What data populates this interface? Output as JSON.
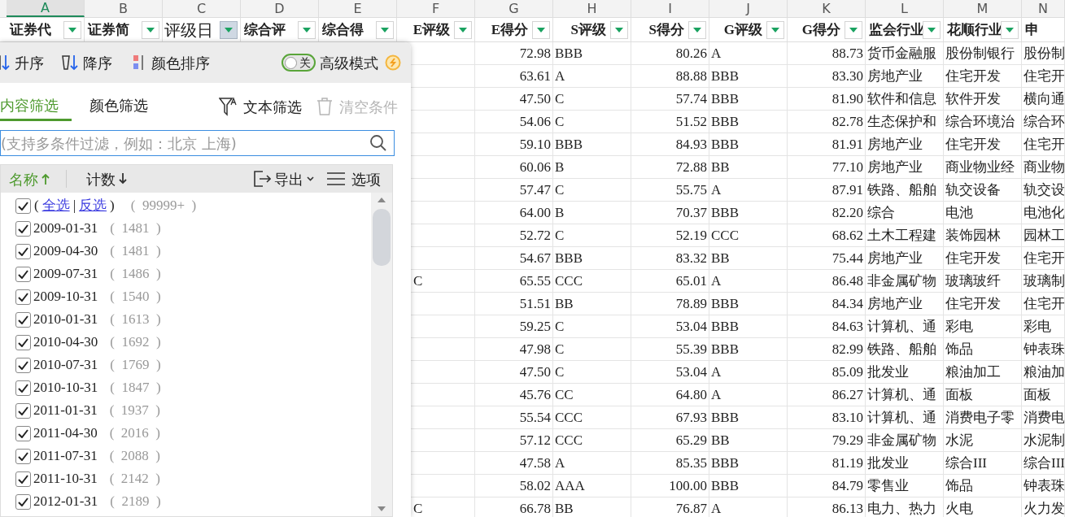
{
  "columns": [
    {
      "letter": "A",
      "header": "证券代",
      "selected": true
    },
    {
      "letter": "B",
      "header": "证券简",
      "selected": false
    },
    {
      "letter": "C",
      "header": "评级日",
      "selected": false,
      "active_filter": true
    },
    {
      "letter": "D",
      "header": "综合评",
      "selected": false
    },
    {
      "letter": "E",
      "header": "综合得",
      "selected": false
    },
    {
      "letter": "F",
      "header": "E评级",
      "selected": false
    },
    {
      "letter": "G",
      "header": "E得分",
      "selected": false
    },
    {
      "letter": "H",
      "header": "S评级",
      "selected": false
    },
    {
      "letter": "I",
      "header": "S得分",
      "selected": false
    },
    {
      "letter": "J",
      "header": "G评级",
      "selected": false
    },
    {
      "letter": "K",
      "header": "G得分",
      "selected": false
    },
    {
      "letter": "L",
      "header": "监会行业",
      "selected": false
    },
    {
      "letter": "M",
      "header": "花顺行业",
      "selected": false
    },
    {
      "letter": "N",
      "header": "申",
      "selected": false
    }
  ],
  "rows": [
    {
      "cells": [
        "72.98",
        "BBB",
        "80.26",
        "A",
        "88.73",
        "货币金融服",
        "股份制银行",
        "股份制"
      ]
    },
    {
      "cells": [
        "63.61",
        "A",
        "88.88",
        "BBB",
        "83.30",
        "房地产业",
        "住宅开发",
        "住宅开"
      ]
    },
    {
      "cells": [
        "47.50",
        "C",
        "57.74",
        "BBB",
        "81.90",
        "软件和信息",
        "软件开发",
        "横向通"
      ]
    },
    {
      "cells": [
        "54.06",
        "C",
        "51.52",
        "BBB",
        "82.78",
        "生态保护和",
        "综合环境治",
        "综合环"
      ]
    },
    {
      "cells": [
        "59.10",
        "BBB",
        "84.93",
        "BBB",
        "81.91",
        "房地产业",
        "住宅开发",
        "住宅开"
      ]
    },
    {
      "cells": [
        "60.06",
        "B",
        "72.88",
        "BB",
        "77.10",
        "房地产业",
        "商业物业经",
        "商业物"
      ]
    },
    {
      "cells": [
        "57.47",
        "C",
        "55.75",
        "A",
        "87.91",
        "铁路、船舶",
        "轨交设备",
        "轨交设"
      ]
    },
    {
      "cells": [
        "64.00",
        "B",
        "70.37",
        "BBB",
        "82.20",
        "综合",
        "电池",
        "电池化"
      ]
    },
    {
      "cells": [
        "52.72",
        "C",
        "52.19",
        "CCC",
        "68.62",
        "土木工程建",
        "装饰园林",
        "园林工"
      ]
    },
    {
      "cells": [
        "54.67",
        "BBB",
        "83.32",
        "BB",
        "75.44",
        "房地产业",
        "住宅开发",
        "住宅开"
      ]
    },
    {
      "f": "C",
      "cells": [
        "65.55",
        "CCC",
        "65.01",
        "A",
        "86.48",
        "非金属矿物",
        "玻璃玻纤",
        "玻璃制"
      ]
    },
    {
      "cells": [
        "51.51",
        "BB",
        "78.89",
        "BBB",
        "84.34",
        "房地产业",
        "住宅开发",
        "住宅开"
      ]
    },
    {
      "cells": [
        "59.25",
        "C",
        "53.04",
        "BBB",
        "84.63",
        "计算机、通",
        "彩电",
        "彩电"
      ]
    },
    {
      "cells": [
        "47.98",
        "C",
        "55.39",
        "BBB",
        "82.99",
        "铁路、船舶",
        "饰品",
        "钟表珠"
      ]
    },
    {
      "cells": [
        "47.50",
        "C",
        "53.04",
        "A",
        "85.09",
        "批发业",
        "粮油加工",
        "粮油加"
      ]
    },
    {
      "cells": [
        "45.76",
        "CC",
        "64.80",
        "A",
        "86.27",
        "计算机、通",
        "面板",
        "面板"
      ]
    },
    {
      "cells": [
        "55.54",
        "CCC",
        "67.93",
        "BBB",
        "83.10",
        "计算机、通",
        "消费电子零",
        "消费电"
      ]
    },
    {
      "cells": [
        "57.12",
        "CCC",
        "65.29",
        "BB",
        "79.29",
        "非金属矿物",
        "水泥",
        "水泥制"
      ]
    },
    {
      "cells": [
        "47.58",
        "A",
        "85.35",
        "BBB",
        "81.19",
        "批发业",
        "综合III",
        "综合III"
      ]
    },
    {
      "cells": [
        "58.02",
        "AAA",
        "100.00",
        "BBB",
        "84.79",
        "零售业",
        "饰品",
        "钟表珠"
      ]
    },
    {
      "f": "C",
      "cells": [
        "66.78",
        "BB",
        "76.87",
        "A",
        "86.13",
        "电力、热力",
        "火电",
        "火力发"
      ]
    }
  ],
  "filter_panel": {
    "sort_buttons": [
      "升序",
      "降序",
      "颜色排序"
    ],
    "advanced_mode": {
      "toggle_text": "关",
      "on": false,
      "label": "高级模式"
    },
    "tabs": [
      {
        "label": "内容筛选",
        "selected": true
      },
      {
        "label": "颜色筛选",
        "selected": false
      }
    ],
    "text_filter": "文本筛选",
    "clear": {
      "label": "清空条件",
      "disabled": true
    },
    "search": {
      "placeholder": "(支持多条件过滤，例如：北京 上海)"
    },
    "list_header": {
      "name": "名称",
      "count": "计数",
      "export": "导出",
      "options": "选项"
    },
    "select_all": {
      "open": "(",
      "all": "全选",
      "sep": "|",
      "invert": "反选",
      "close": ")",
      "count": "(  99999+  )",
      "checked": true
    },
    "items": [
      {
        "label": "2009-01-31",
        "count": "(  1481  )",
        "checked": true
      },
      {
        "label": "2009-04-30",
        "count": "(  1481  )",
        "checked": true
      },
      {
        "label": "2009-07-31",
        "count": "(  1486  )",
        "checked": true
      },
      {
        "label": "2009-10-31",
        "count": "(  1540  )",
        "checked": true
      },
      {
        "label": "2010-01-31",
        "count": "(  1613  )",
        "checked": true
      },
      {
        "label": "2010-04-30",
        "count": "(  1692  )",
        "checked": true
      },
      {
        "label": "2010-07-31",
        "count": "(  1769  )",
        "checked": true
      },
      {
        "label": "2010-10-31",
        "count": "(  1847  )",
        "checked": true
      },
      {
        "label": "2011-01-31",
        "count": "(  1937  )",
        "checked": true
      },
      {
        "label": "2011-04-30",
        "count": "(  2016  )",
        "checked": true
      },
      {
        "label": "2011-07-31",
        "count": "(  2088  )",
        "checked": true
      },
      {
        "label": "2011-10-31",
        "count": "(  2142  )",
        "checked": true
      },
      {
        "label": "2012-01-31",
        "count": "(  2189  )",
        "checked": true
      }
    ]
  }
}
